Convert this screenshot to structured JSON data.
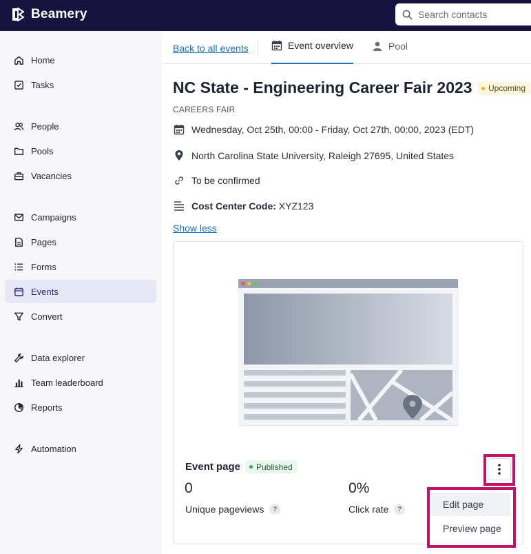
{
  "app": {
    "brand": "Beamery"
  },
  "search": {
    "placeholder": "Search contacts"
  },
  "sidebar": {
    "items": [
      {
        "label": "Home",
        "icon": "home-icon"
      },
      {
        "label": "Tasks",
        "icon": "tasks-icon"
      },
      {
        "label": "People",
        "icon": "people-icon"
      },
      {
        "label": "Pools",
        "icon": "folder-icon"
      },
      {
        "label": "Vacancies",
        "icon": "briefcase-icon"
      },
      {
        "label": "Campaigns",
        "icon": "mail-icon"
      },
      {
        "label": "Pages",
        "icon": "page-icon"
      },
      {
        "label": "Forms",
        "icon": "list-icon"
      },
      {
        "label": "Events",
        "icon": "calendar-icon",
        "active": true
      },
      {
        "label": "Convert",
        "icon": "funnel-icon"
      },
      {
        "label": "Data explorer",
        "icon": "wrench-icon"
      },
      {
        "label": "Team leaderboard",
        "icon": "bar-chart-icon"
      },
      {
        "label": "Reports",
        "icon": "pie-chart-icon"
      },
      {
        "label": "Automation",
        "icon": "bolt-icon"
      }
    ]
  },
  "tabs": {
    "back_label": "Back to all events",
    "overview_label": "Event overview",
    "pool_label": "Pool"
  },
  "event": {
    "title": "NC State - Engineering Career Fair 2023",
    "status": "Upcoming",
    "category": "CAREERS FAIR",
    "dates": "Wednesday, Oct 25th, 00:00 - Friday, Oct 27th, 00:00, 2023 (EDT)",
    "location": "North Carolina State University, Raleigh 27695, United States",
    "link": "To be confirmed",
    "cost_center_label": "Cost Center Code:",
    "cost_center_value": "XYZ123",
    "show_less": "Show less"
  },
  "event_page": {
    "label": "Event page",
    "status": "Published",
    "pageviews_value": "0",
    "pageviews_label": "Unique pageviews",
    "click_rate_value": "0%",
    "click_rate_label": "Click rate",
    "help": "?"
  },
  "menu": {
    "edit": "Edit page",
    "preview": "Preview page"
  },
  "colors": {
    "topbar": "#16143f",
    "accent": "#1a6fb5",
    "highlight": "#c1126b",
    "upcoming_dot": "#e5b422",
    "published_dot": "#3aa363"
  }
}
